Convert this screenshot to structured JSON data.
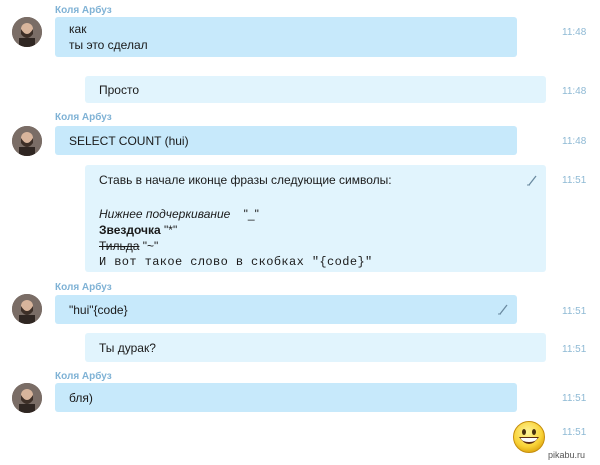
{
  "sender_name": "Коля Арбуз",
  "messages": [
    {
      "lines": [
        "как",
        "ты это сделал"
      ],
      "time": "11:48"
    },
    {
      "lines": [
        "Просто"
      ],
      "time": "11:48"
    },
    {
      "lines": [
        "SELECT COUNT (hui)"
      ],
      "time": "11:48"
    },
    {
      "intro": "Ставь в начале иконце фразы следующие символы:",
      "italic_label": "Нижнее подчеркивание",
      "italic_symbol": "\"_\"",
      "bold_label": "Звездочка",
      "bold_symbol": "\"*\"",
      "strike_label": "Тильда",
      "strike_symbol": "\"~\"",
      "mono_text": "И вот такое слово в скобках \"{code}\"",
      "time": "11:51"
    },
    {
      "lines": [
        "\"hui\"{code}"
      ],
      "time": "11:51"
    },
    {
      "lines": [
        "Ты дурак?"
      ],
      "time": "11:51"
    },
    {
      "lines": [
        "бля)"
      ],
      "time": "11:51"
    },
    {
      "time": "11:51"
    }
  ],
  "icons": {
    "edit": "pencil-edit-icon",
    "avatar": "user-avatar",
    "emoji": "grinning-emoji-icon"
  },
  "watermark": "pikabu.ru",
  "colors": {
    "incoming": "#c7e9fb",
    "outgoing": "#e1f4fd",
    "name": "#7fb2d5",
    "time": "#8eb9d4"
  }
}
